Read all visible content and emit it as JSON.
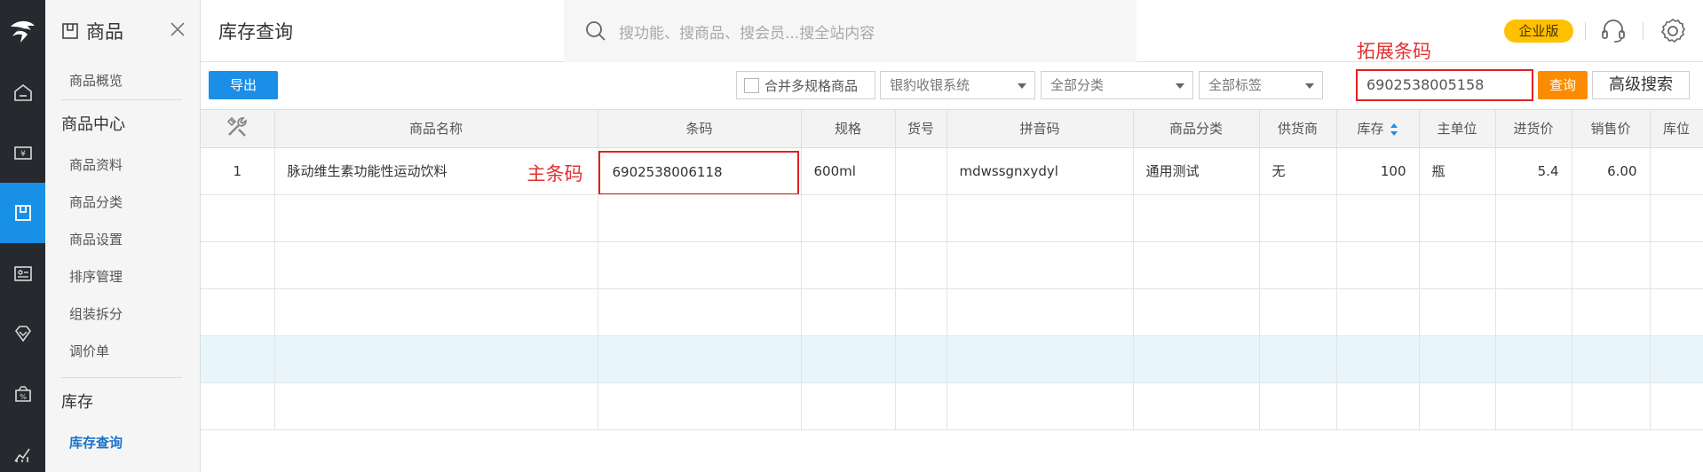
{
  "sidebar": {
    "module_title": "商品",
    "items": [
      {
        "label": "商品概览",
        "type": "item"
      },
      {
        "label": "商品中心",
        "type": "section"
      },
      {
        "label": "商品资料",
        "type": "item"
      },
      {
        "label": "商品分类",
        "type": "item"
      },
      {
        "label": "商品设置",
        "type": "item"
      },
      {
        "label": "排序管理",
        "type": "item"
      },
      {
        "label": "组装拆分",
        "type": "item"
      },
      {
        "label": "调价单",
        "type": "item"
      },
      {
        "label": "库存",
        "type": "section"
      },
      {
        "label": "库存查询",
        "type": "item-active"
      }
    ]
  },
  "header": {
    "page_title": "库存查询",
    "search_placeholder": "搜功能、搜商品、搜会员...搜全站内容",
    "edition_badge": "企业版"
  },
  "toolbar": {
    "export_label": "导出",
    "merge_checkbox_label": "合并多规格商品",
    "merge_checked": false,
    "system_select": "银豹收银系统",
    "category_select": "全部分类",
    "tag_select": "全部标签",
    "barcode_value": "6902538005158",
    "query_label": "查询",
    "advanced_label": "高级搜索"
  },
  "annotations": {
    "extended_barcode": "拓展条码",
    "main_barcode": "主条码"
  },
  "table": {
    "columns": [
      "",
      "商品名称",
      "条码",
      "规格",
      "货号",
      "拼音码",
      "商品分类",
      "供货商",
      "库存",
      "主单位",
      "进货价",
      "销售价",
      "库位"
    ],
    "rows": [
      {
        "index": "1",
        "name": "脉动维生素功能性运动饮料",
        "barcode": "6902538006118",
        "spec": "600ml",
        "sku": "",
        "pinyin": "mdwssgnxydyl",
        "category": "通用测试",
        "supplier": "无",
        "stock": "100",
        "unit": "瓶",
        "cost": "5.4",
        "price": "6.00",
        "location": ""
      }
    ]
  },
  "colors": {
    "rail_bg": "#26292e",
    "rail_active": "#1890e6",
    "primary_button": "#1b8ee8",
    "query_button": "#fb8c00",
    "badge": "#ffc000",
    "annotation_red": "#e02020",
    "highlight_row": "#e8f6fc"
  }
}
